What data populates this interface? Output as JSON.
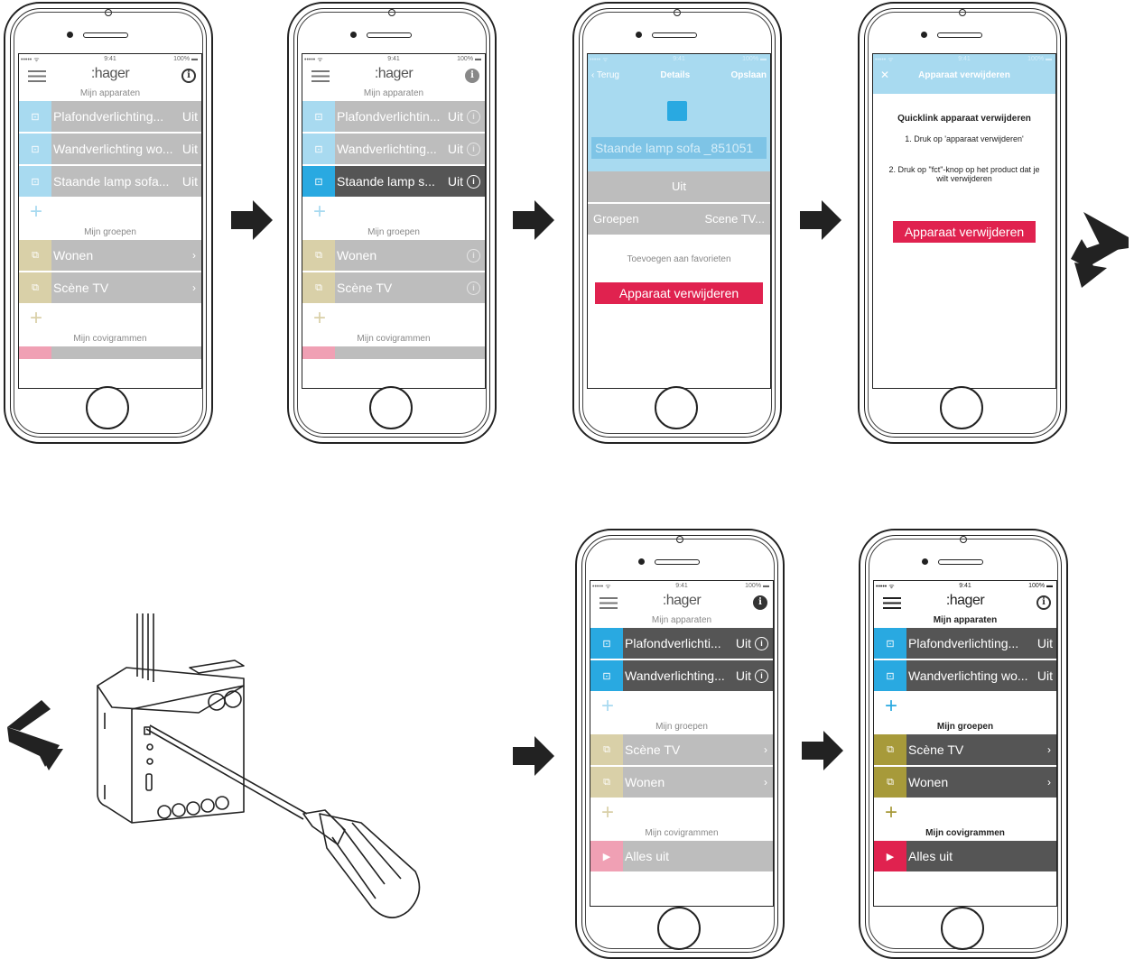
{
  "status": {
    "signal": "••••• ᯤ",
    "time": "9:41",
    "battery": "100% ▬"
  },
  "logo": ":hager",
  "icons": {
    "info": "i",
    "chevron": "›",
    "plus": "+",
    "close": "✕"
  },
  "p1": {
    "apparaten_title": "Mijn apparaten",
    "devices": [
      {
        "label": "Plafondverlichting...",
        "value": "Uit"
      },
      {
        "label": "Wandverlichting wo...",
        "value": "Uit"
      },
      {
        "label": "Staande lamp sofa...",
        "value": "Uit"
      }
    ],
    "groepen_title": "Mijn groepen",
    "groups": [
      {
        "label": "Wonen"
      },
      {
        "label": "Scène TV"
      }
    ],
    "covi_title": "Mijn covigrammen"
  },
  "p2": {
    "apparaten_title": "Mijn apparaten",
    "devices": [
      {
        "label": "Plafondverlichtin...",
        "value": "Uit"
      },
      {
        "label": "Wandverlichting...",
        "value": "Uit"
      },
      {
        "label": "Staande lamp s...",
        "value": "Uit"
      }
    ],
    "groepen_title": "Mijn groepen",
    "groups": [
      {
        "label": "Wonen"
      },
      {
        "label": "Scène TV"
      }
    ],
    "covi_title": "Mijn covigrammen"
  },
  "p3": {
    "back": "‹ Terug",
    "title": "Details",
    "save": "Opslaan",
    "device_name": "Staande lamp sofa _851051",
    "state": "Uit",
    "groepen_label": "Groepen",
    "groepen_value": "Scene TV...",
    "favorites": "Toevoegen aan favorieten",
    "delete_btn": "Apparaat verwijderen"
  },
  "p4": {
    "title": "Apparaat verwijderen",
    "heading": "Quicklink apparaat verwijderen",
    "step1": "1. Druk op 'apparaat verwijderen'",
    "step2": "2. Druk op \"fct\"-knop op het product dat je wilt verwijderen",
    "delete_btn": "Apparaat verwijderen"
  },
  "p5": {
    "apparaten_title": "Mijn apparaten",
    "devices": [
      {
        "label": "Plafondverlichti...",
        "value": "Uit"
      },
      {
        "label": "Wandverlichting...",
        "value": "Uit"
      }
    ],
    "groepen_title": "Mijn groepen",
    "groups": [
      {
        "label": "Scène TV"
      },
      {
        "label": "Wonen"
      }
    ],
    "covi_title": "Mijn covigrammen",
    "covigrams": [
      {
        "label": "Alles uit"
      }
    ]
  },
  "p6": {
    "apparaten_title": "Mijn apparaten",
    "devices": [
      {
        "label": "Plafondverlichting...",
        "value": "Uit"
      },
      {
        "label": "Wandverlichting wo...",
        "value": "Uit"
      }
    ],
    "groepen_title": "Mijn groepen",
    "groups": [
      {
        "label": "Scène TV"
      },
      {
        "label": "Wonen"
      }
    ],
    "covi_title": "Mijn covigrammen",
    "covigrams": [
      {
        "label": "Alles uit"
      }
    ]
  },
  "colors": {
    "accent_blue": "#29a9e1",
    "light_blue": "#a8daf0",
    "red": "#e0224f",
    "olive": "#a79a3a",
    "grey_row": "#bdbdbd",
    "dark_row": "#555555"
  }
}
